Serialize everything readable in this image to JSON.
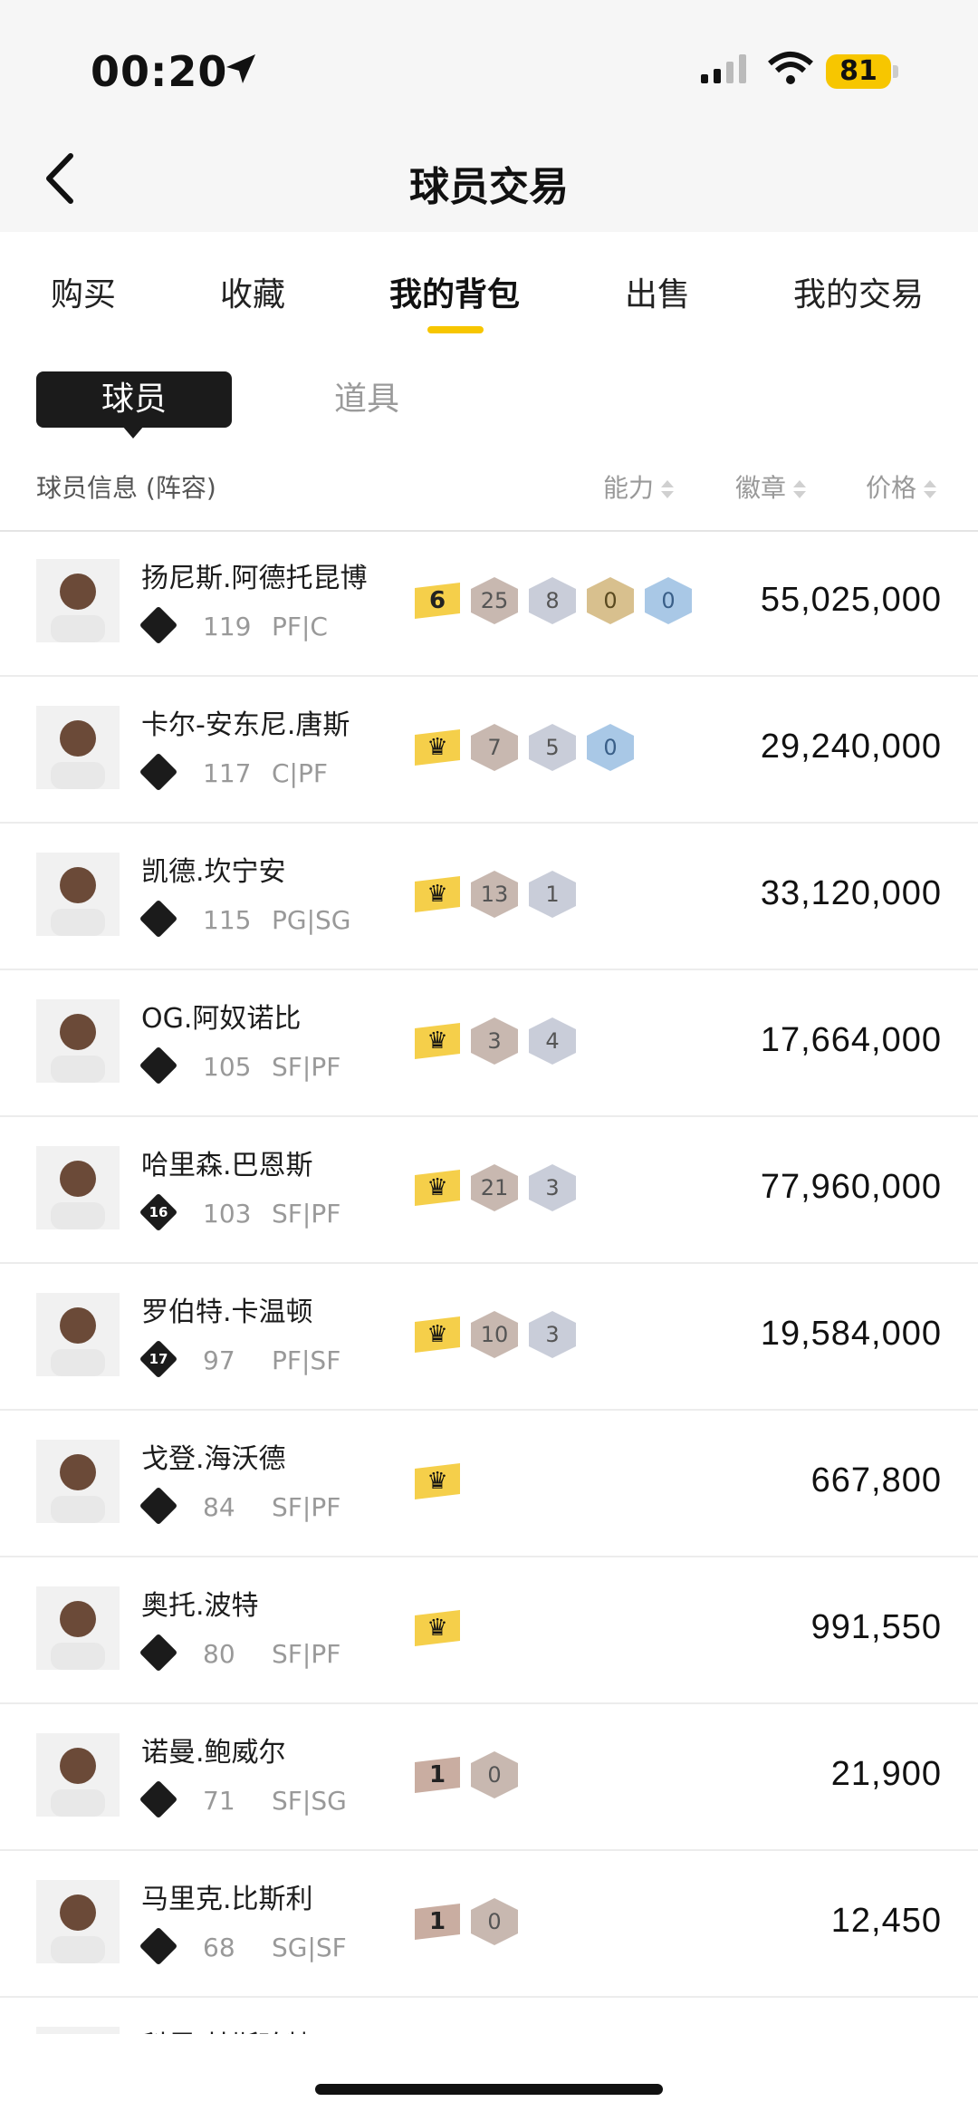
{
  "status_bar": {
    "time": "00:20",
    "battery": "81",
    "icons": [
      "location-arrow-icon",
      "signal-icon",
      "wifi-icon",
      "battery-icon"
    ]
  },
  "nav": {
    "title": "球员交易",
    "back_icon": "chevron-left-icon"
  },
  "tabs": [
    {
      "label": "购买",
      "active": false
    },
    {
      "label": "收藏",
      "active": false
    },
    {
      "label": "我的背包",
      "active": true
    },
    {
      "label": "出售",
      "active": false
    },
    {
      "label": "我的交易",
      "active": false
    }
  ],
  "segment": {
    "active": "球员",
    "inactive": "道具"
  },
  "table_header": {
    "info": "球员信息 (阵容)",
    "ability": "能力",
    "badges": "徽章",
    "price": "价格"
  },
  "colors": {
    "accent": "#f7c600",
    "dark": "#1b1b1b"
  },
  "players": [
    {
      "name": "扬尼斯.阿德托昆博",
      "rating": "119",
      "pos": "PF|C",
      "icon": "",
      "tier": {
        "type": "num",
        "value": "6",
        "color": "gold"
      },
      "badges": [
        {
          "v": "25",
          "c": "bronze"
        },
        {
          "v": "8",
          "c": "silver"
        },
        {
          "v": "0",
          "c": "gold"
        },
        {
          "v": "0",
          "c": "blue"
        }
      ],
      "price": "55,025,000"
    },
    {
      "name": "卡尔-安东尼.唐斯",
      "rating": "117",
      "pos": "C|PF",
      "icon": "",
      "tier": {
        "type": "crown",
        "color": "gold"
      },
      "badges": [
        {
          "v": "7",
          "c": "bronze"
        },
        {
          "v": "5",
          "c": "silver"
        },
        {
          "v": "0",
          "c": "blue"
        }
      ],
      "price": "29,240,000"
    },
    {
      "name": "凯德.坎宁安",
      "rating": "115",
      "pos": "PG|SG",
      "icon": "",
      "tier": {
        "type": "crown",
        "color": "gold"
      },
      "badges": [
        {
          "v": "13",
          "c": "bronze"
        },
        {
          "v": "1",
          "c": "silver"
        }
      ],
      "price": "33,120,000"
    },
    {
      "name": "OG.阿奴诺比",
      "rating": "105",
      "pos": "SF|PF",
      "icon": "",
      "tier": {
        "type": "crown",
        "color": "gold"
      },
      "badges": [
        {
          "v": "3",
          "c": "bronze"
        },
        {
          "v": "4",
          "c": "silver"
        }
      ],
      "price": "17,664,000"
    },
    {
      "name": "哈里森.巴恩斯",
      "rating": "103",
      "pos": "SF|PF",
      "icon": "16",
      "tier": {
        "type": "crown",
        "color": "gold"
      },
      "badges": [
        {
          "v": "21",
          "c": "bronze"
        },
        {
          "v": "3",
          "c": "silver"
        }
      ],
      "price": "77,960,000"
    },
    {
      "name": "罗伯特.卡温顿",
      "rating": "97",
      "pos": "PF|SF",
      "icon": "17",
      "tier": {
        "type": "crown",
        "color": "gold"
      },
      "badges": [
        {
          "v": "10",
          "c": "bronze"
        },
        {
          "v": "3",
          "c": "silver"
        }
      ],
      "price": "19,584,000"
    },
    {
      "name": "戈登.海沃德",
      "rating": "84",
      "pos": "SF|PF",
      "icon": "",
      "tier": {
        "type": "crown",
        "color": "gold"
      },
      "badges": [],
      "price": "667,800"
    },
    {
      "name": "奥托.波特",
      "rating": "80",
      "pos": "SF|PF",
      "icon": "",
      "tier": {
        "type": "crown",
        "color": "gold"
      },
      "badges": [],
      "price": "991,550"
    },
    {
      "name": "诺曼.鲍威尔",
      "rating": "71",
      "pos": "SF|SG",
      "icon": "",
      "tier": {
        "type": "num",
        "value": "1",
        "color": "bronze"
      },
      "badges": [
        {
          "v": "0",
          "c": "bronze"
        }
      ],
      "price": "21,900"
    },
    {
      "name": "马里克.比斯利",
      "rating": "68",
      "pos": "SG|SF",
      "icon": "",
      "tier": {
        "type": "num",
        "value": "1",
        "color": "bronze"
      },
      "badges": [
        {
          "v": "0",
          "c": "bronze"
        }
      ],
      "price": "12,450"
    },
    {
      "name": "科里.基斯珀特",
      "rating": "",
      "pos": "",
      "icon": "",
      "tier": null,
      "badges": [],
      "price": ""
    }
  ]
}
